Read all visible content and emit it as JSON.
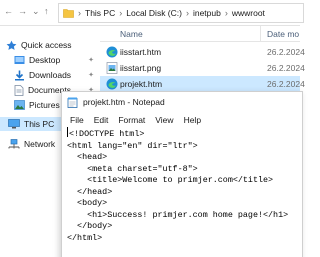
{
  "explorer": {
    "breadcrumb": [
      "This PC",
      "Local Disk (C:)",
      "inetpub",
      "wwwroot"
    ],
    "columns": {
      "name": "Name",
      "date": "Date mo"
    },
    "sidebar": [
      {
        "label": "Quick access",
        "icon": "star-icon",
        "pinned": false
      },
      {
        "label": "Desktop",
        "icon": "desktop-folder-icon",
        "pinned": true
      },
      {
        "label": "Downloads",
        "icon": "download-icon",
        "pinned": true
      },
      {
        "label": "Documents",
        "icon": "documents-icon",
        "pinned": true
      },
      {
        "label": "Pictures",
        "icon": "pictures-icon",
        "pinned": false
      },
      {
        "label": "This PC",
        "icon": "computer-icon",
        "pinned": false
      },
      {
        "label": "Network",
        "icon": "network-icon",
        "pinned": false
      }
    ],
    "files": [
      {
        "name": "iisstart.htm",
        "date": "26.2.2024",
        "icon": "edge-file-icon"
      },
      {
        "name": "iisstart.png",
        "date": "26.2.2024",
        "icon": "image-file-icon"
      },
      {
        "name": "projekt.htm",
        "date": "26.2.2024",
        "icon": "edge-file-icon",
        "selected": true
      }
    ]
  },
  "notepad": {
    "title": "projekt.htm - Notepad",
    "menu": [
      "File",
      "Edit",
      "Format",
      "View",
      "Help"
    ],
    "lines": [
      "<!DOCTYPE html>",
      "<html lang=\"en\" dir=\"ltr\">",
      "  <head>",
      "    <meta charset=\"utf-8\">",
      "    <title>Welcome to primjer.com</title>",
      "  </head>",
      "  <body>",
      "    <h1>Success! primjer.com home page!</h1>",
      "  </body>",
      "</html>"
    ]
  },
  "colors": {
    "selection": "#cce8ff",
    "folder": "#f5c542",
    "edge": "#1f8fd6"
  }
}
